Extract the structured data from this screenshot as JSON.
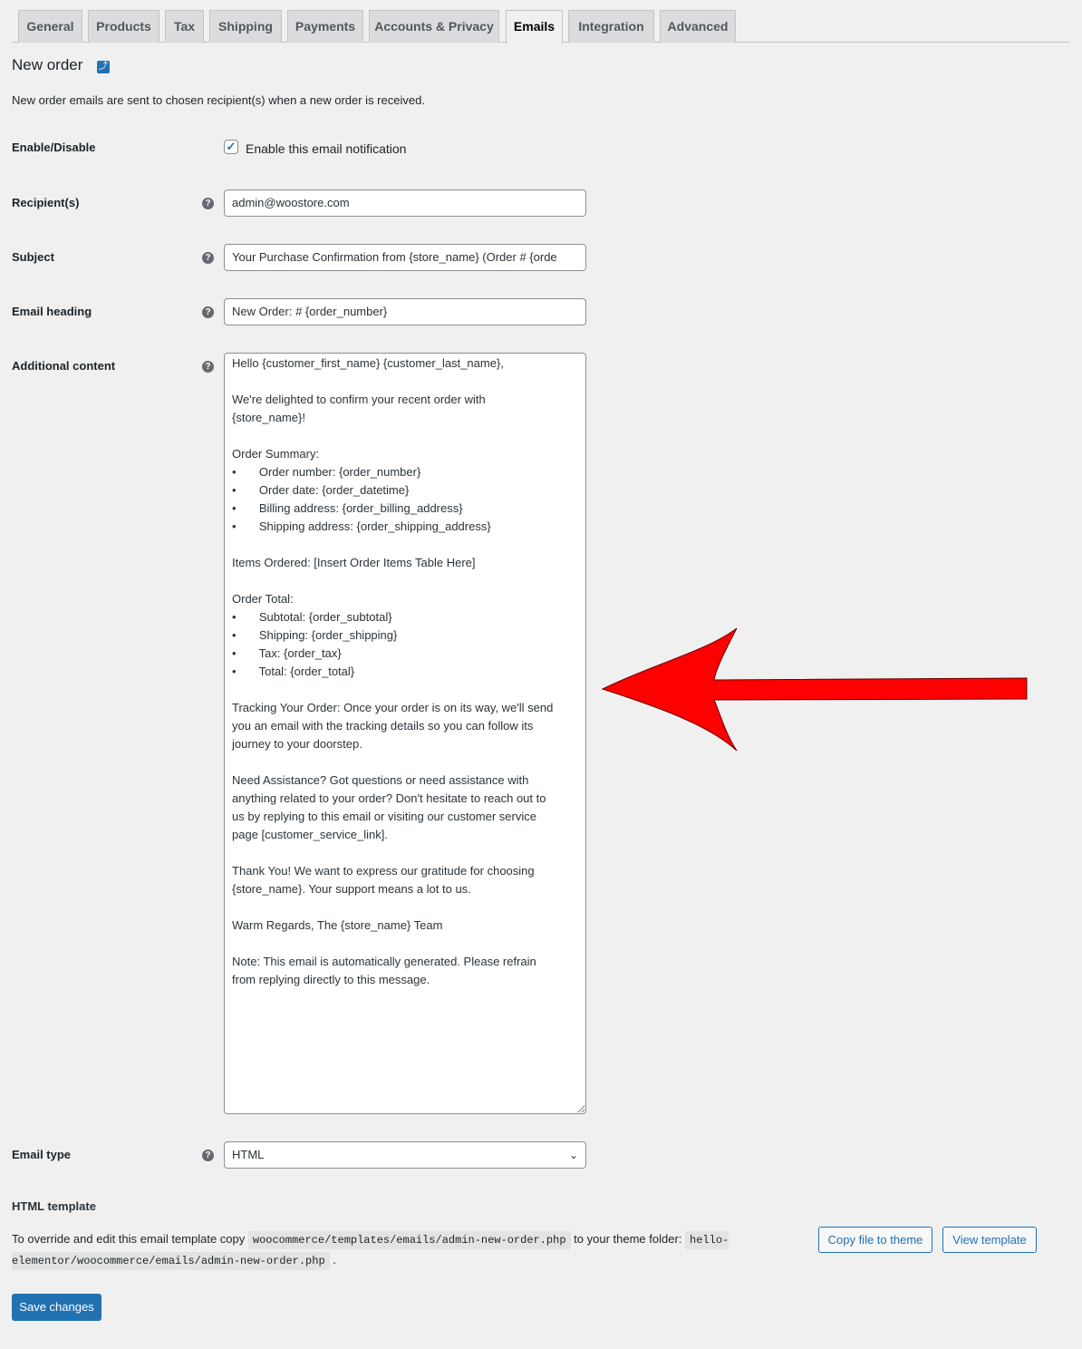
{
  "tabs": [
    "General",
    "Products",
    "Tax",
    "Shipping",
    "Payments",
    "Accounts & Privacy",
    "Emails",
    "Integration",
    "Advanced"
  ],
  "active_tab": "Emails",
  "title": "New order",
  "description": "New order emails are sent to chosen recipient(s) when a new order is received.",
  "fields": {
    "enable": {
      "label": "Enable/Disable",
      "checkbox_label": "Enable this email notification",
      "checked": true
    },
    "recipient": {
      "label": "Recipient(s)",
      "value": "admin@woostore.com"
    },
    "subject": {
      "label": "Subject",
      "value": "Your Purchase Confirmation from {store_name} (Order # {orde"
    },
    "heading": {
      "label": "Email heading",
      "value": "New Order: # {order_number}"
    },
    "additional": {
      "label": "Additional content",
      "value": "Hello {customer_first_name} {customer_last_name},\n\nWe're delighted to confirm your recent order with\n{store_name}!\n\nOrder Summary:\n•       Order number: {order_number}\n•       Order date: {order_datetime}\n•       Billing address: {order_billing_address}\n•       Shipping address: {order_shipping_address}\n\nItems Ordered: [Insert Order Items Table Here]\n\nOrder Total:\n•       Subtotal: {order_subtotal}\n•       Shipping: {order_shipping}\n•       Tax: {order_tax}\n•       Total: {order_total}\n\nTracking Your Order: Once your order is on its way, we'll send\nyou an email with the tracking details so you can follow its\njourney to your doorstep.\n\nNeed Assistance? Got questions or need assistance with\nanything related to your order? Don't hesitate to reach out to\nus by replying to this email or visiting our customer service\npage [customer_service_link].\n\nThank You! We want to express our gratitude for choosing\n{store_name}. Your support means a lot to us.\n\nWarm Regards, The {store_name} Team\n\nNote: This email is automatically generated. Please refrain\nfrom replying directly to this message."
    },
    "email_type": {
      "label": "Email type",
      "value": "HTML"
    }
  },
  "template": {
    "heading": "HTML template",
    "text1": "To override and edit this email template copy",
    "path1": "woocommerce/templates/emails/admin-new-order.php",
    "text2": "to your theme folder:",
    "path2": "hello-elementor/woocommerce/emails/admin-new-order.php",
    "text3": ".",
    "copy_button": "Copy file to theme",
    "view_button": "View template"
  },
  "save_button": "Save changes",
  "annotation_arrow_color": "#ff0000"
}
